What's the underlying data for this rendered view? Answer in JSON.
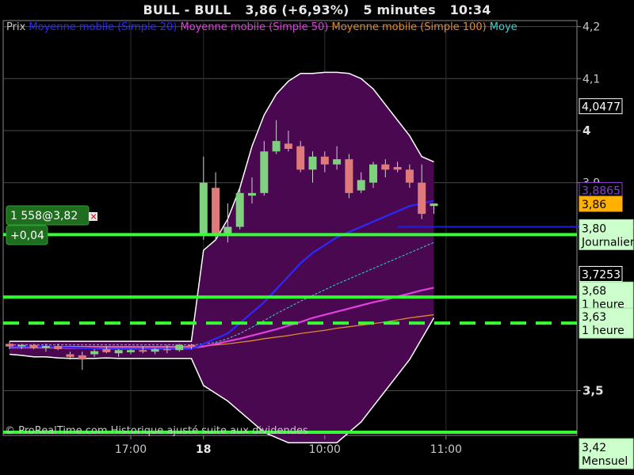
{
  "header": {
    "symbol": "BULL - BULL",
    "price_change": "3,86 (+6,93%)",
    "timeframe": "5 minutes",
    "time": "10:34"
  },
  "legend": [
    {
      "label": "Prix",
      "color": "#c8c8c8"
    },
    {
      "label": "Moyenne mobile (Simple 20)",
      "color": "#2a2aff"
    },
    {
      "label": "Moyenne mobile (Simple 50)",
      "color": "#e040e0"
    },
    {
      "label": "Moyenne mobile (Simple 100)",
      "color": "#e08a30"
    },
    {
      "label": "Moye",
      "color": "#40d0d0"
    }
  ],
  "copyright": "© ProRealTime.com Historique ajusté suite aux dividendes",
  "colors": {
    "up": "#7fd07f",
    "down": "#e07a7a",
    "bollinger_fill": "#4a0850",
    "level_green": "#33ff33",
    "level_blue": "#2020e0"
  },
  "chart_data": {
    "type": "candlestick",
    "ylim": [
      3.42,
      4.22
    ],
    "y_ticks": [
      {
        "value": 4.2,
        "label": "4,2",
        "major": false
      },
      {
        "value": 4.1,
        "label": "4,1",
        "major": false
      },
      {
        "value": 4.0,
        "label": "4",
        "major": true
      },
      {
        "value": 3.9,
        "label": "3,9",
        "major": false
      },
      {
        "value": 3.5,
        "label": "3,5",
        "major": true
      }
    ],
    "x_ticks": [
      {
        "index": 10,
        "label": "17:00",
        "bold": false
      },
      {
        "index": 16,
        "label": "18",
        "bold": true
      },
      {
        "index": 26,
        "label": "10:00",
        "bold": false
      },
      {
        "index": 36,
        "label": "11:00",
        "bold": false
      }
    ],
    "candles": [
      {
        "o": 3.59,
        "h": 3.595,
        "l": 3.58,
        "c": 3.585
      },
      {
        "o": 3.585,
        "h": 3.59,
        "l": 3.58,
        "c": 3.588
      },
      {
        "o": 3.588,
        "h": 3.59,
        "l": 3.58,
        "c": 3.582
      },
      {
        "o": 3.582,
        "h": 3.59,
        "l": 3.575,
        "c": 3.586
      },
      {
        "o": 3.586,
        "h": 3.59,
        "l": 3.578,
        "c": 3.58
      },
      {
        "o": 3.57,
        "h": 3.575,
        "l": 3.56,
        "c": 3.565
      },
      {
        "o": 3.568,
        "h": 3.575,
        "l": 3.54,
        "c": 3.56
      },
      {
        "o": 3.57,
        "h": 3.58,
        "l": 3.565,
        "c": 3.576
      },
      {
        "o": 3.58,
        "h": 3.585,
        "l": 3.572,
        "c": 3.574
      },
      {
        "o": 3.572,
        "h": 3.58,
        "l": 3.565,
        "c": 3.578
      },
      {
        "o": 3.574,
        "h": 3.58,
        "l": 3.57,
        "c": 3.578
      },
      {
        "o": 3.578,
        "h": 3.585,
        "l": 3.572,
        "c": 3.575
      },
      {
        "o": 3.575,
        "h": 3.582,
        "l": 3.57,
        "c": 3.58
      },
      {
        "o": 3.58,
        "h": 3.588,
        "l": 3.572,
        "c": 3.578
      },
      {
        "o": 3.578,
        "h": 3.59,
        "l": 3.575,
        "c": 3.588
      },
      {
        "o": 3.588,
        "h": 3.59,
        "l": 3.58,
        "c": 3.585
      },
      {
        "o": 3.8,
        "h": 3.95,
        "l": 3.79,
        "c": 3.9
      },
      {
        "o": 3.89,
        "h": 3.92,
        "l": 3.79,
        "c": 3.8
      },
      {
        "o": 3.8,
        "h": 3.86,
        "l": 3.785,
        "c": 3.815
      },
      {
        "o": 3.815,
        "h": 3.89,
        "l": 3.81,
        "c": 3.88
      },
      {
        "o": 3.875,
        "h": 3.91,
        "l": 3.86,
        "c": 3.88
      },
      {
        "o": 3.88,
        "h": 3.98,
        "l": 3.875,
        "c": 3.96
      },
      {
        "o": 3.96,
        "h": 4.02,
        "l": 3.955,
        "c": 3.98
      },
      {
        "o": 3.975,
        "h": 4.0,
        "l": 3.96,
        "c": 3.965
      },
      {
        "o": 3.97,
        "h": 3.98,
        "l": 3.92,
        "c": 3.925
      },
      {
        "o": 3.925,
        "h": 3.96,
        "l": 3.9,
        "c": 3.95
      },
      {
        "o": 3.95,
        "h": 3.96,
        "l": 3.92,
        "c": 3.935
      },
      {
        "o": 3.935,
        "h": 3.97,
        "l": 3.925,
        "c": 3.945
      },
      {
        "o": 3.945,
        "h": 3.955,
        "l": 3.87,
        "c": 3.88
      },
      {
        "o": 3.885,
        "h": 3.92,
        "l": 3.88,
        "c": 3.905
      },
      {
        "o": 3.9,
        "h": 3.94,
        "l": 3.89,
        "c": 3.935
      },
      {
        "o": 3.935,
        "h": 3.945,
        "l": 3.91,
        "c": 3.925
      },
      {
        "o": 3.93,
        "h": 3.94,
        "l": 3.92,
        "c": 3.925
      },
      {
        "o": 3.925,
        "h": 3.935,
        "l": 3.89,
        "c": 3.9
      },
      {
        "o": 3.9,
        "h": 3.935,
        "l": 3.83,
        "c": 3.84
      },
      {
        "o": 3.855,
        "h": 3.86,
        "l": 3.84,
        "c": 3.86
      }
    ],
    "bollinger_upper": [
      3.595,
      3.595,
      3.595,
      3.595,
      3.595,
      3.595,
      3.595,
      3.595,
      3.595,
      3.595,
      3.595,
      3.595,
      3.595,
      3.595,
      3.595,
      3.595,
      3.77,
      3.79,
      3.83,
      3.89,
      3.97,
      4.03,
      4.07,
      4.095,
      4.11,
      4.11,
      4.112,
      4.112,
      4.11,
      4.1,
      4.08,
      4.05,
      4.02,
      3.99,
      3.95,
      3.94
    ],
    "bollinger_lower": [
      3.57,
      3.568,
      3.565,
      3.565,
      3.563,
      3.562,
      3.562,
      3.562,
      3.563,
      3.562,
      3.562,
      3.562,
      3.562,
      3.562,
      3.562,
      3.562,
      3.51,
      3.495,
      3.48,
      3.46,
      3.44,
      3.42,
      3.41,
      3.4,
      3.4,
      3.4,
      3.4,
      3.4,
      3.42,
      3.44,
      3.47,
      3.5,
      3.53,
      3.56,
      3.6,
      3.64
    ],
    "sma20": [
      3.585,
      3.585,
      3.585,
      3.585,
      3.584,
      3.583,
      3.582,
      3.581,
      3.58,
      3.58,
      3.58,
      3.58,
      3.58,
      3.58,
      3.58,
      3.58,
      3.59,
      3.6,
      3.61,
      3.63,
      3.65,
      3.67,
      3.695,
      3.72,
      3.745,
      3.765,
      3.78,
      3.795,
      3.805,
      3.815,
      3.825,
      3.835,
      3.845,
      3.855,
      3.86,
      3.865
    ],
    "sma50": [
      3.583,
      3.583,
      3.583,
      3.583,
      3.583,
      3.582,
      3.582,
      3.582,
      3.582,
      3.582,
      3.582,
      3.582,
      3.582,
      3.582,
      3.582,
      3.582,
      3.585,
      3.59,
      3.595,
      3.6,
      3.606,
      3.612,
      3.618,
      3.625,
      3.632,
      3.64,
      3.646,
      3.652,
      3.658,
      3.664,
      3.67,
      3.675,
      3.681,
      3.687,
      3.693,
      3.698
    ],
    "sma100": [
      3.585,
      3.585,
      3.585,
      3.585,
      3.585,
      3.585,
      3.585,
      3.585,
      3.585,
      3.585,
      3.585,
      3.585,
      3.585,
      3.585,
      3.585,
      3.585,
      3.586,
      3.588,
      3.59,
      3.593,
      3.596,
      3.6,
      3.603,
      3.606,
      3.61,
      3.613,
      3.616,
      3.62,
      3.623,
      3.626,
      3.629,
      3.632,
      3.636,
      3.64,
      3.643,
      3.646
    ],
    "sma_extra": [
      3.588,
      3.588,
      3.588,
      3.588,
      3.588,
      3.588,
      3.588,
      3.588,
      3.588,
      3.588,
      3.588,
      3.588,
      3.588,
      3.588,
      3.588,
      3.588,
      3.59,
      3.593,
      3.6,
      3.61,
      3.622,
      3.635,
      3.648,
      3.66,
      3.672,
      3.683,
      3.694,
      3.705,
      3.715,
      3.725,
      3.735,
      3.745,
      3.755,
      3.765,
      3.775,
      3.785
    ],
    "horizontal_levels": [
      {
        "value": 3.8,
        "style": "solid",
        "color": "#33ff33",
        "label": "3,80",
        "sub": "Journalier"
      },
      {
        "value": 3.68,
        "style": "solid",
        "color": "#33ff33",
        "label": "3,68",
        "sub": "1 heure"
      },
      {
        "value": 3.63,
        "style": "dashed",
        "color": "#33ff33",
        "label": "3,63",
        "sub": "1 heure"
      },
      {
        "value": 3.42,
        "style": "solid",
        "color": "#33ff33",
        "label": "3,42",
        "sub": "Mensuel"
      },
      {
        "value": 3.815,
        "style": "solid",
        "color": "#2020e0",
        "label": null,
        "sub": null
      }
    ],
    "price_boxes": [
      {
        "value": 4.0477,
        "label": "4,0477",
        "bg": "#000000",
        "fg": "#ffffff",
        "border": "#ffffff"
      },
      {
        "value": 3.8865,
        "label": "3,8865",
        "bg": "#000000",
        "fg": "#8a3fd0",
        "border": "#8a3fd0"
      },
      {
        "value": 3.86,
        "label": "3,86",
        "bg": "#ffb000",
        "fg": "#000000",
        "border": "#ffb000"
      },
      {
        "value": 3.7253,
        "label": "3,7253",
        "bg": "#000000",
        "fg": "#ffffff",
        "border": "#ffffff"
      }
    ],
    "position": {
      "qty_price": "1 558@3,82",
      "pnl": "+0,04"
    }
  }
}
